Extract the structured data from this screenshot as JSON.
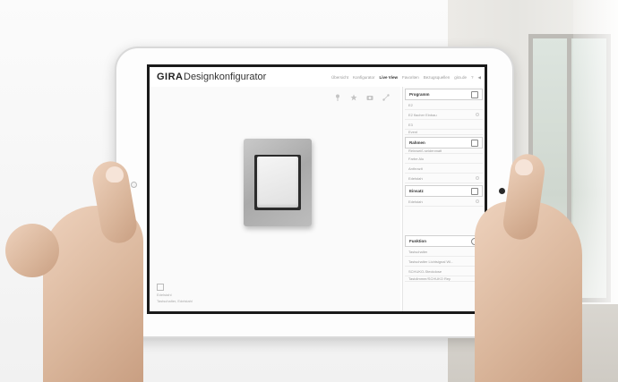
{
  "app": {
    "logo": "GIRA",
    "title": "Designkonfigurator"
  },
  "nav": {
    "items": [
      "Übersicht",
      "Konfigurator",
      "Live View",
      "Favoriten",
      "Bezugsquellen",
      "gira.de",
      "?",
      "◀"
    ],
    "active_index": 2
  },
  "toolbar_icons": [
    "pin-icon",
    "favorite-icon",
    "camera-icon",
    "share-icon"
  ],
  "panel": {
    "sections": [
      {
        "title": "Programm",
        "icon": "layers-icon",
        "items": [
          "E2",
          "E2 flacher Einbau",
          "E3",
          "Event"
        ]
      },
      {
        "title": "Rahmen",
        "icon": "frame-icon",
        "items": [
          "Reinweiß seidenmatt",
          "Farbe Alu",
          "Anthrazit",
          "Edelstahl"
        ]
      },
      {
        "title": "Einsatz",
        "icon": "insert-icon",
        "items": [
          "Edelstahl"
        ]
      },
      {
        "title": "Funktion",
        "icon": "sun-icon",
        "items": [
          "Tastschalter",
          "Tastschalter Lichtsignal Wi...",
          "SCHUKO-Steckdose",
          "Tastdimmer/SCHUKO Rep"
        ]
      }
    ]
  },
  "canvas_footer": {
    "line1": "Edelstahl",
    "line2": "Tastschalter, Edelstahl"
  },
  "colors": {
    "screen_border": "#1a1a1a",
    "frame_aluminium": "#b5b5b5",
    "rocker_white": "#eeeeee"
  }
}
